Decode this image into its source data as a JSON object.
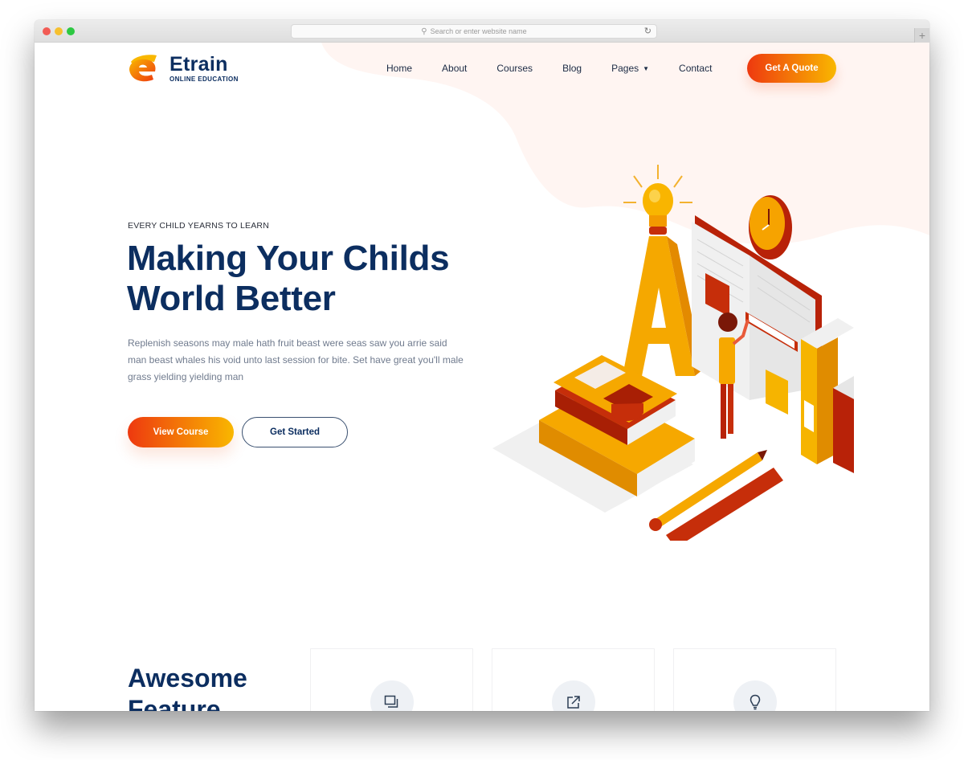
{
  "browser": {
    "url_placeholder": "Search or enter website name",
    "new_tab_label": "+"
  },
  "brand": {
    "name": "Etrain",
    "tagline": "ONLINE EDUCATION"
  },
  "nav": {
    "items": [
      {
        "label": "Home"
      },
      {
        "label": "About"
      },
      {
        "label": "Courses"
      },
      {
        "label": "Blog"
      },
      {
        "label": "Pages",
        "dropdown": true
      },
      {
        "label": "Contact"
      }
    ],
    "cta_label": "Get A Quote"
  },
  "hero": {
    "eyebrow": "EVERY CHILD YEARNS TO LEARN",
    "title_line1": "Making Your Childs",
    "title_line2": "World Better",
    "description": "Replenish seasons may male hath fruit beast were seas saw you arrie said man beast whales his void unto last session for bite. Set have great you'll male grass yielding yielding man",
    "primary_button": "View Course",
    "secondary_button": "Get Started"
  },
  "features": {
    "title_line1": "Awesome",
    "title_line2": "Feature",
    "cards": [
      {
        "icon": "copy-icon"
      },
      {
        "icon": "external-link-icon"
      },
      {
        "icon": "lightbulb-icon"
      }
    ]
  },
  "colors": {
    "brand_navy": "#0c2e60",
    "gradient_start": "#ee390f",
    "gradient_end": "#f9b700",
    "blob_pink": "#fff5f2"
  }
}
